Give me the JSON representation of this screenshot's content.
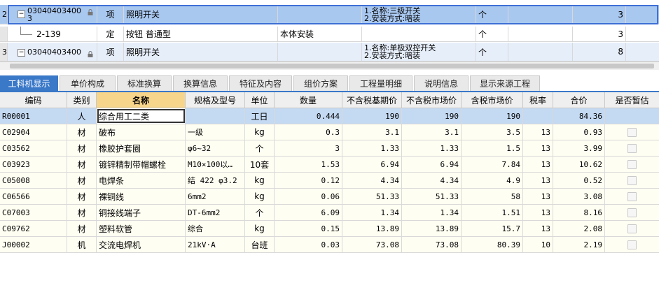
{
  "top_rows": [
    {
      "rownum": "2",
      "code_line1": "03040403400",
      "code_line2": "3",
      "type": "项",
      "name": "照明开关",
      "content": "",
      "feature_line1": "1.名称:三级开关",
      "feature_line2": "2.安装方式:暗装",
      "unit": "个",
      "qty": "3",
      "state": "selected"
    },
    {
      "rownum": "",
      "code_line1": "2-139",
      "code_line2": "",
      "type": "定",
      "name": "按钮 普通型",
      "content": "本体安装",
      "feature_line1": "",
      "feature_line2": "",
      "unit": "个",
      "qty": "3",
      "state": "normal"
    },
    {
      "rownum": "3",
      "code_line1": "03040403400",
      "code_line2": "",
      "type": "项",
      "name": "照明开关",
      "content": "",
      "feature_line1": "1.名称:单极双控开关",
      "feature_line2": "2.安装方式:暗装",
      "unit": "个",
      "qty": "8",
      "state": "alt"
    }
  ],
  "tabs": [
    "工料机显示",
    "单价构成",
    "标准换算",
    "换算信息",
    "特征及内容",
    "组价方案",
    "工程量明细",
    "说明信息",
    "显示来源工程"
  ],
  "columns": [
    "编码",
    "类别",
    "名称",
    "规格及型号",
    "单位",
    "数量",
    "不含税基期价",
    "不含税市场价",
    "含税市场价",
    "税率",
    "合价",
    "是否暂估"
  ],
  "rows": [
    {
      "code": "R00001",
      "cat": "人",
      "name": "综合用工二类",
      "spec": "",
      "unit": "工日",
      "qty": "0.444",
      "base": "190",
      "market": "190",
      "market_tax": "190",
      "rate": "",
      "total": "84.36"
    },
    {
      "code": "C02904",
      "cat": "材",
      "name": "破布",
      "spec": "一级",
      "unit": "kg",
      "qty": "0.3",
      "base": "3.1",
      "market": "3.1",
      "market_tax": "3.5",
      "rate": "13",
      "total": "0.93"
    },
    {
      "code": "C03562",
      "cat": "材",
      "name": "橡胶护套圈",
      "spec": "φ6~32",
      "unit": "个",
      "qty": "3",
      "base": "1.33",
      "market": "1.33",
      "market_tax": "1.5",
      "rate": "13",
      "total": "3.99"
    },
    {
      "code": "C03923",
      "cat": "材",
      "name": "镀锌精制带帽螺栓",
      "spec": "M10×100以…",
      "unit": "10套",
      "qty": "1.53",
      "base": "6.94",
      "market": "6.94",
      "market_tax": "7.84",
      "rate": "13",
      "total": "10.62"
    },
    {
      "code": "C05008",
      "cat": "材",
      "name": "电焊条",
      "spec": "结 422 φ3.2",
      "unit": "kg",
      "qty": "0.12",
      "base": "4.34",
      "market": "4.34",
      "market_tax": "4.9",
      "rate": "13",
      "total": "0.52"
    },
    {
      "code": "C06566",
      "cat": "材",
      "name": "裸铜线",
      "spec": "6mm2",
      "unit": "kg",
      "qty": "0.06",
      "base": "51.33",
      "market": "51.33",
      "market_tax": "58",
      "rate": "13",
      "total": "3.08"
    },
    {
      "code": "C07003",
      "cat": "材",
      "name": "铜接线端子",
      "spec": "DT-6mm2",
      "unit": "个",
      "qty": "6.09",
      "base": "1.34",
      "market": "1.34",
      "market_tax": "1.51",
      "rate": "13",
      "total": "8.16"
    },
    {
      "code": "C09762",
      "cat": "材",
      "name": "塑料软管",
      "spec": "综合",
      "unit": "kg",
      "qty": "0.15",
      "base": "13.89",
      "market": "13.89",
      "market_tax": "15.7",
      "rate": "13",
      "total": "2.08"
    },
    {
      "code": "J00002",
      "cat": "机",
      "name": "交流电焊机",
      "spec": "21kV·A",
      "unit": "台班",
      "qty": "0.03",
      "base": "73.08",
      "market": "73.08",
      "market_tax": "80.39",
      "rate": "10",
      "total": "2.19"
    }
  ]
}
